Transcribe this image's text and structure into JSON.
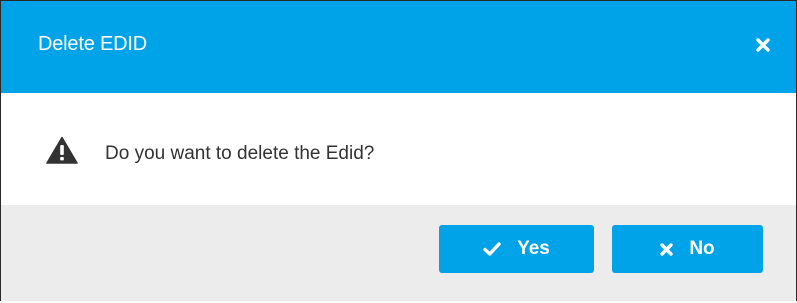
{
  "dialog": {
    "title": "Delete EDID",
    "close_icon": "close-icon",
    "message": "Do you want to delete the Edid?",
    "warning_icon": "warning-triangle-icon",
    "buttons": {
      "yes_label": "Yes",
      "yes_icon": "checkmark-icon",
      "no_label": "No",
      "no_icon": "x-icon"
    }
  },
  "colors": {
    "header_background": "#00a2e8",
    "button_background": "#00a2e8",
    "footer_background": "#ececec",
    "message_text": "#333333"
  }
}
